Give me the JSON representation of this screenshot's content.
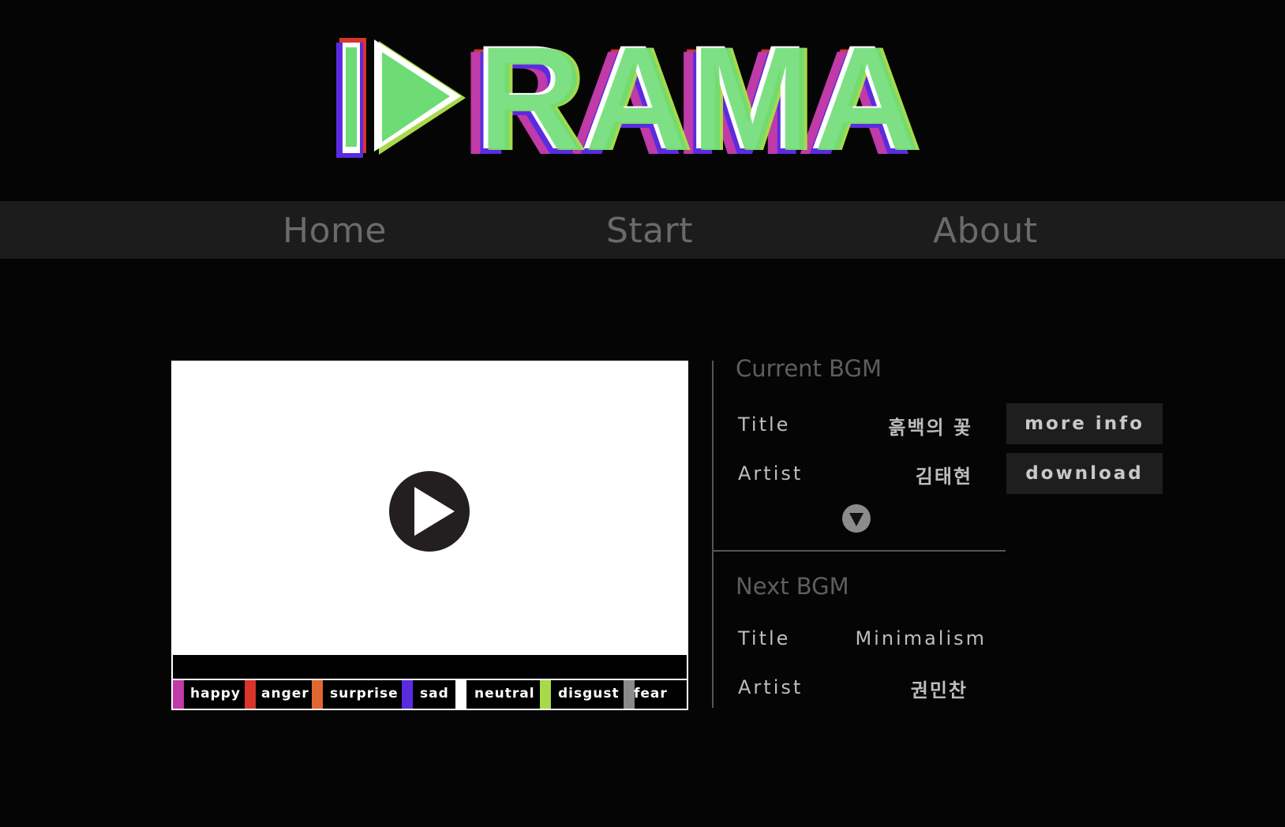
{
  "logo": {
    "text": "RAMA"
  },
  "nav": {
    "items": [
      "Home",
      "Start",
      "About"
    ]
  },
  "video": {
    "legend": [
      {
        "label": "happy",
        "color": "#c03aa8"
      },
      {
        "label": "anger",
        "color": "#d8352b"
      },
      {
        "label": "surprise",
        "color": "#e0672f"
      },
      {
        "label": "sad",
        "color": "#5b2be0"
      },
      {
        "label": "neutral",
        "color": "#ffffff"
      },
      {
        "label": "disgust",
        "color": "#a8d94a"
      },
      {
        "label": "fear",
        "color": "#8a8a8a"
      }
    ]
  },
  "current_bgm": {
    "heading": "Current BGM",
    "title_label": "Title",
    "title_value": "흙백의 꽃",
    "artist_label": "Artist",
    "artist_value": "김태현",
    "more_info_label": "more info",
    "download_label": "download"
  },
  "next_bgm": {
    "heading": "Next BGM",
    "title_label": "Title",
    "title_value": "Minimalism",
    "artist_label": "Artist",
    "artist_value": "권민찬"
  }
}
